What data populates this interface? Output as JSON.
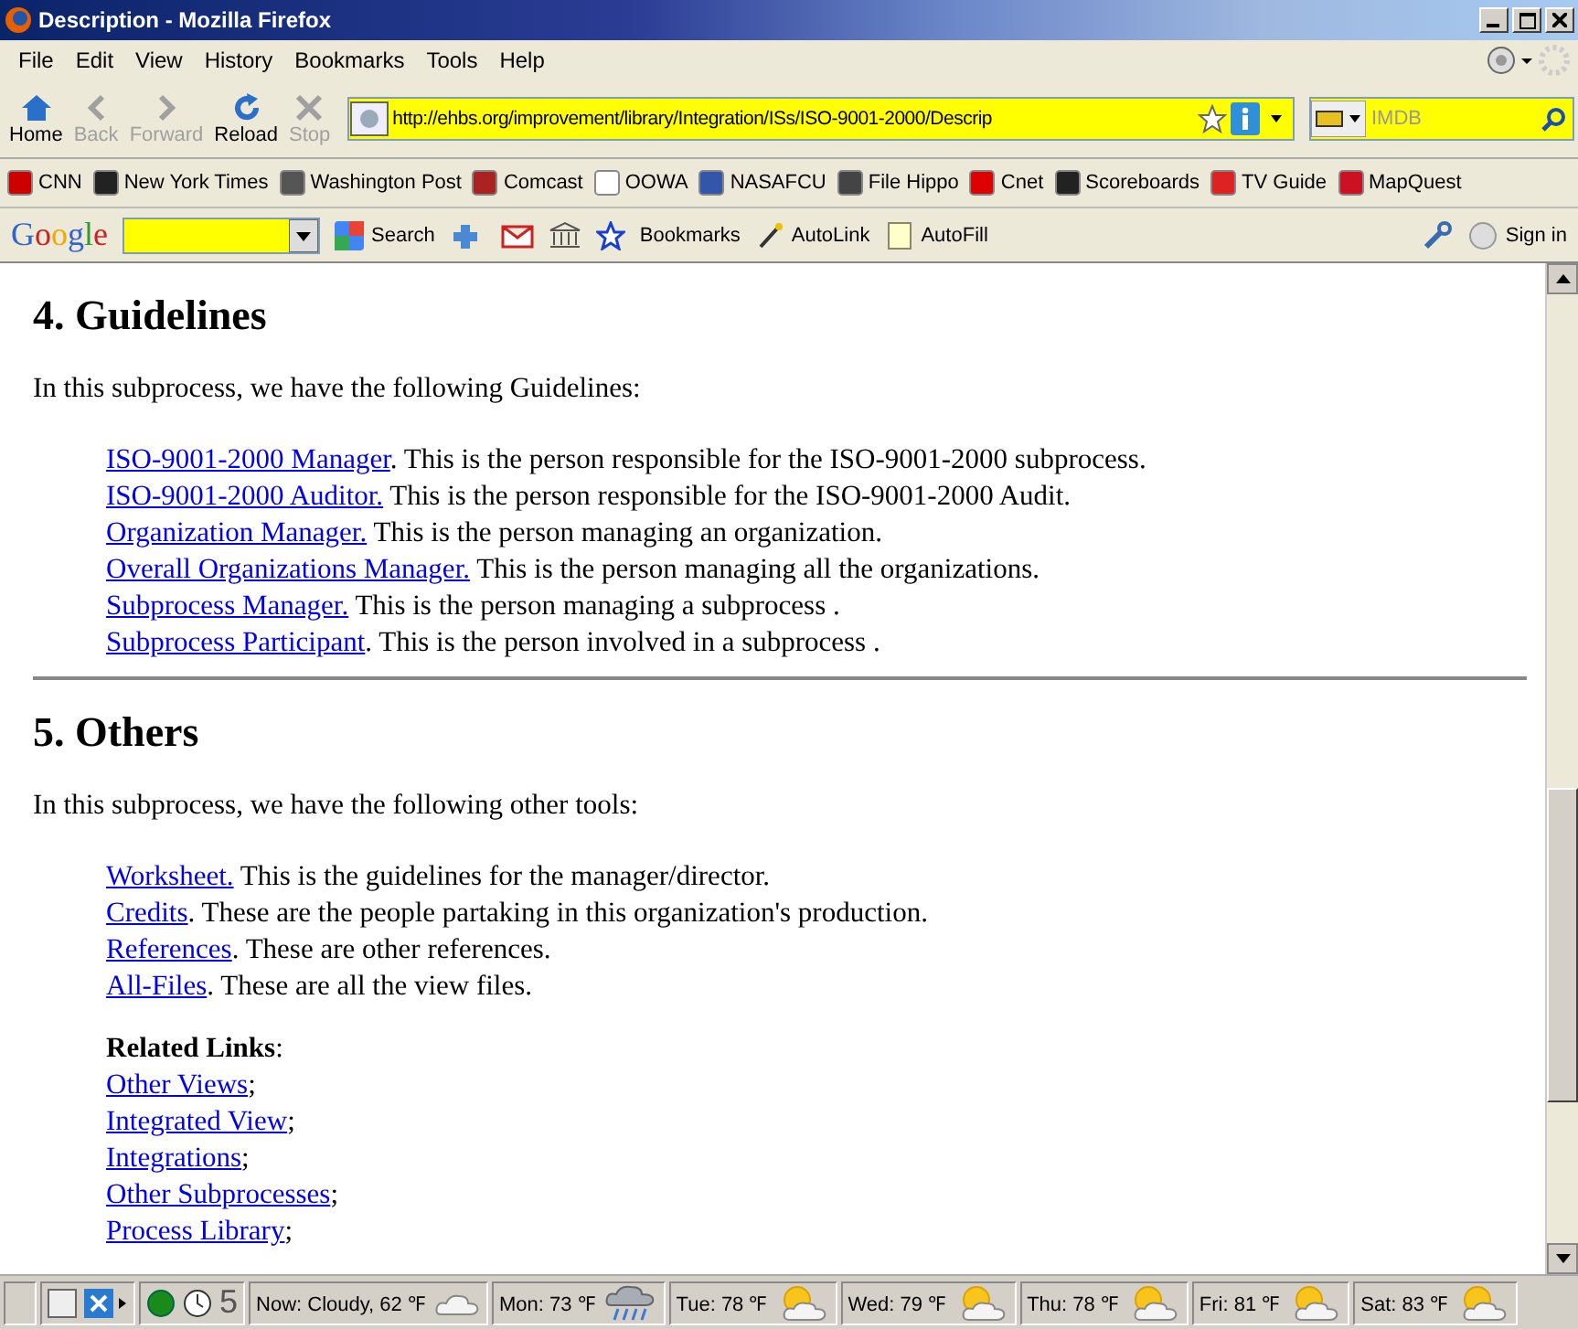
{
  "window": {
    "title": "Description - Mozilla Firefox"
  },
  "menu": [
    "File",
    "Edit",
    "View",
    "History",
    "Bookmarks",
    "Tools",
    "Help"
  ],
  "nav_buttons": [
    {
      "label": "Home",
      "kind": "home",
      "disabled": false
    },
    {
      "label": "Back",
      "kind": "back",
      "disabled": true
    },
    {
      "label": "Forward",
      "kind": "forward",
      "disabled": true
    },
    {
      "label": "Reload",
      "kind": "reload",
      "disabled": false
    },
    {
      "label": "Stop",
      "kind": "stop",
      "disabled": true
    }
  ],
  "address": {
    "value": "http://ehbs.org/improvement/library/Integration/ISs/ISO-9001-2000/Descrip"
  },
  "search": {
    "placeholder": "IMDB"
  },
  "bookmarks": [
    {
      "label": "CNN",
      "color": "#cc0000"
    },
    {
      "label": "New York Times",
      "color": "#222222"
    },
    {
      "label": "Washington Post",
      "color": "#555555"
    },
    {
      "label": "Comcast",
      "color": "#aa2222"
    },
    {
      "label": "OOWA",
      "color": "#ffffff"
    },
    {
      "label": "NASAFCU",
      "color": "#3355aa"
    },
    {
      "label": "File Hippo",
      "color": "#444444"
    },
    {
      "label": "Cnet",
      "color": "#dd0000"
    },
    {
      "label": "Scoreboards",
      "color": "#222222"
    },
    {
      "label": "TV Guide",
      "color": "#dd2222"
    },
    {
      "label": "MapQuest",
      "color": "#cc1122"
    }
  ],
  "google_toolbar": {
    "logo": "Google",
    "items": [
      "Search",
      "Bookmarks",
      "AutoLink",
      "AutoFill",
      "Sign in"
    ]
  },
  "sections": [
    {
      "heading": "4. Guidelines",
      "intro": "In this subprocess, we have the following Guidelines:",
      "items": [
        {
          "link": "ISO-9001-2000 Manager",
          "text": ". This is the person responsible for the ISO-9001-2000 subprocess."
        },
        {
          "link": "ISO-9001-2000 Auditor.",
          "text": " This is the person responsible for the ISO-9001-2000 Audit."
        },
        {
          "link": "Organization Manager.",
          "text": " This is the person managing an organization."
        },
        {
          "link": "Overall Organizations Manager.",
          "text": " This is the person managing all the organizations."
        },
        {
          "link": "Subprocess Manager.",
          "text": " This is the person managing a subprocess ."
        },
        {
          "link": "Subprocess Participant",
          "text": ". This is the person involved in a subprocess ."
        }
      ]
    },
    {
      "heading": "5. Others",
      "intro": "In this subprocess, we have the following other tools:",
      "items": [
        {
          "link": "Worksheet.",
          "text": " This is the guidelines for the manager/director."
        },
        {
          "link": "Credits",
          "text": ". These are the people partaking in this organization's production."
        },
        {
          "link": "References",
          "text": ". These are other references."
        },
        {
          "link": "All-Files",
          "text": ". These are all the view files."
        }
      ]
    }
  ],
  "related": {
    "title": "Related Links",
    "colon": ":",
    "links": [
      {
        "link": "Other Views",
        "text": ";"
      },
      {
        "link": "Integrated View",
        "text": ";"
      },
      {
        "link": "Integrations",
        "text": ";"
      },
      {
        "link": "Other Subprocesses",
        "text": ";"
      },
      {
        "link": "Process Library",
        "text": ";"
      }
    ]
  },
  "status_bar": {
    "counter": "5",
    "weather": [
      {
        "label": "Now: Cloudy, 62 ℉",
        "kind": "cloud"
      },
      {
        "label": "Mon: 73 ℉",
        "kind": "rain"
      },
      {
        "label": "Tue: 78 ℉",
        "kind": "sun"
      },
      {
        "label": "Wed: 79 ℉",
        "kind": "sun"
      },
      {
        "label": "Thu: 78 ℉",
        "kind": "sun"
      },
      {
        "label": "Fri: 81 ℉",
        "kind": "sun"
      },
      {
        "label": "Sat: 83 ℉",
        "kind": "sun"
      }
    ]
  }
}
